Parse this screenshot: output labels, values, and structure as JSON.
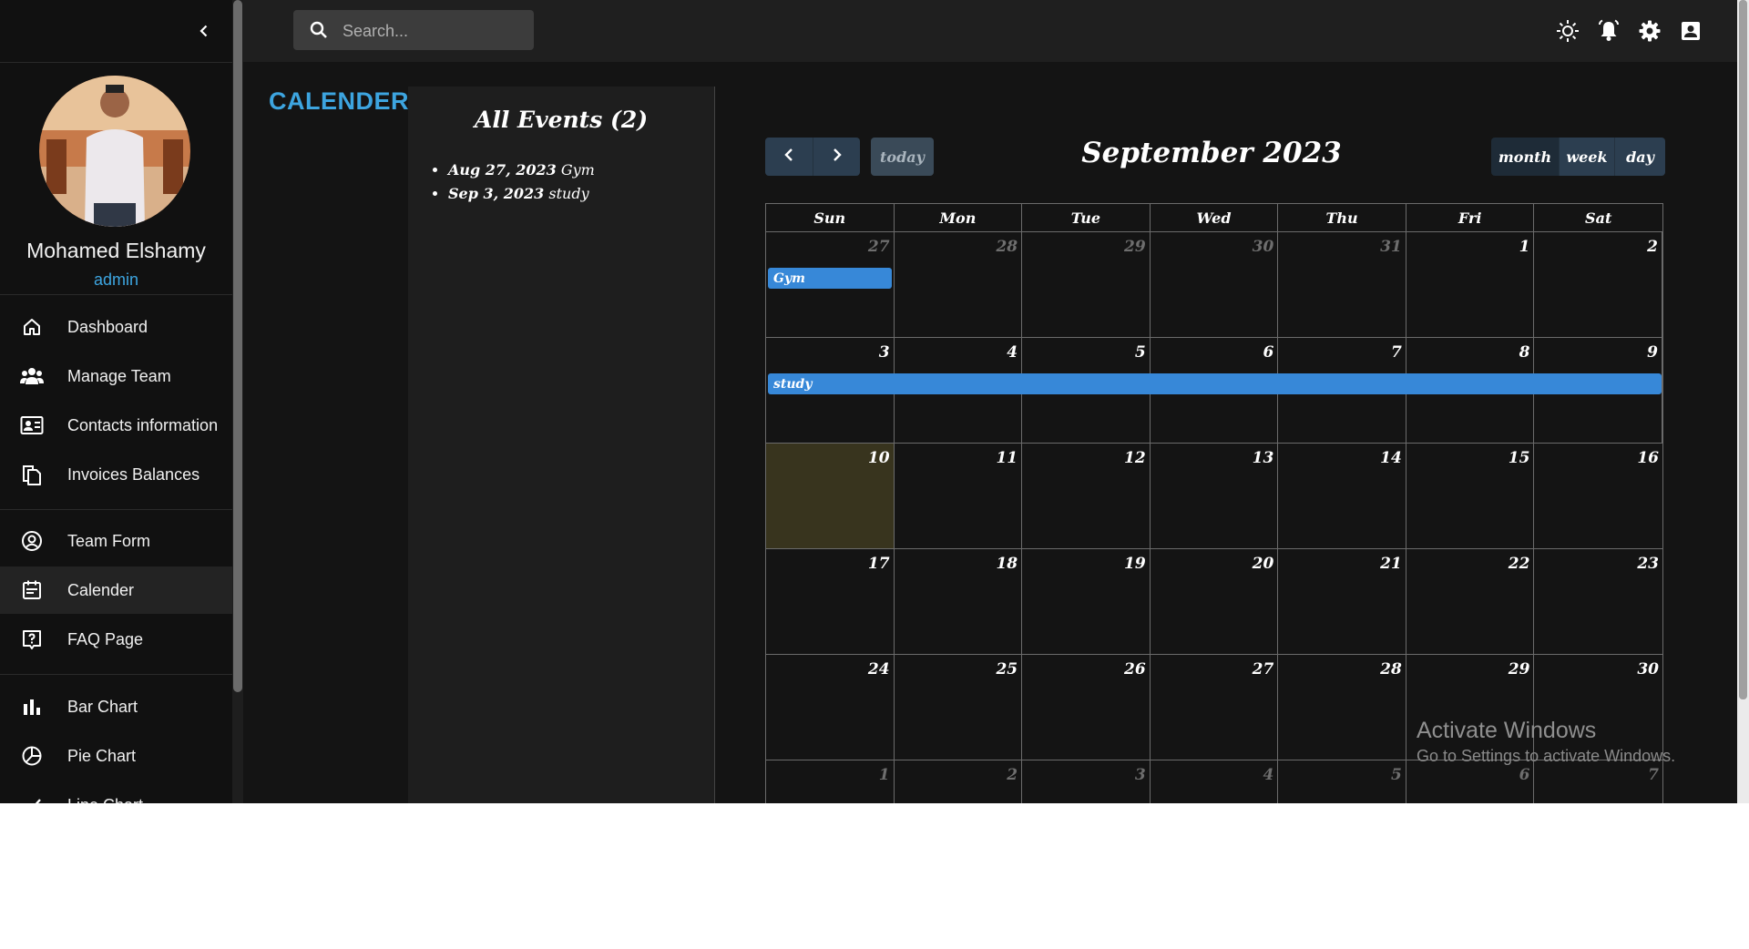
{
  "sidebar": {
    "user": {
      "name": "Mohamed Elshamy",
      "role": "admin"
    },
    "items": [
      {
        "label": "Dashboard",
        "icon": "home-icon"
      },
      {
        "label": "Manage Team",
        "icon": "people-icon"
      },
      {
        "label": "Contacts information",
        "icon": "contacts-card-icon"
      },
      {
        "label": "Invoices Balances",
        "icon": "receipt-icon"
      },
      {
        "label": "Team Form",
        "icon": "person-circle-icon"
      },
      {
        "label": "Calender",
        "icon": "calendar-icon",
        "active": true
      },
      {
        "label": "FAQ Page",
        "icon": "help-icon"
      },
      {
        "label": "Bar Chart",
        "icon": "bar-chart-icon"
      },
      {
        "label": "Pie Chart",
        "icon": "pie-chart-icon"
      },
      {
        "label": "Line Chart",
        "icon": "line-chart-icon"
      }
    ]
  },
  "topbar": {
    "search_placeholder": "Search...",
    "icons": [
      "light-mode-icon",
      "notifications-icon",
      "settings-icon",
      "account-box-icon"
    ]
  },
  "page": {
    "title": "CALENDER"
  },
  "events_panel": {
    "title": "All Events (2)",
    "events": [
      {
        "date": "Aug 27, 2023",
        "title": "Gym"
      },
      {
        "date": "Sep 3, 2023",
        "title": "study"
      }
    ]
  },
  "calendar": {
    "title": "September 2023",
    "today_label": "today",
    "views": [
      "month",
      "week",
      "day"
    ],
    "active_view": "month",
    "weekdays": [
      "Sun",
      "Mon",
      "Tue",
      "Wed",
      "Thu",
      "Fri",
      "Sat"
    ],
    "weeks": [
      [
        {
          "d": "27",
          "o": true
        },
        {
          "d": "28",
          "o": true
        },
        {
          "d": "29",
          "o": true
        },
        {
          "d": "30",
          "o": true
        },
        {
          "d": "31",
          "o": true
        },
        {
          "d": "1"
        },
        {
          "d": "2"
        }
      ],
      [
        {
          "d": "3"
        },
        {
          "d": "4"
        },
        {
          "d": "5"
        },
        {
          "d": "6"
        },
        {
          "d": "7"
        },
        {
          "d": "8"
        },
        {
          "d": "9"
        }
      ],
      [
        {
          "d": "10",
          "t": true
        },
        {
          "d": "11"
        },
        {
          "d": "12"
        },
        {
          "d": "13"
        },
        {
          "d": "14"
        },
        {
          "d": "15"
        },
        {
          "d": "16"
        }
      ],
      [
        {
          "d": "17"
        },
        {
          "d": "18"
        },
        {
          "d": "19"
        },
        {
          "d": "20"
        },
        {
          "d": "21"
        },
        {
          "d": "22"
        },
        {
          "d": "23"
        }
      ],
      [
        {
          "d": "24"
        },
        {
          "d": "25"
        },
        {
          "d": "26"
        },
        {
          "d": "27"
        },
        {
          "d": "28"
        },
        {
          "d": "29"
        },
        {
          "d": "30"
        }
      ],
      [
        {
          "d": "1",
          "o": true
        },
        {
          "d": "2",
          "o": true
        },
        {
          "d": "3",
          "o": true
        },
        {
          "d": "4",
          "o": true
        },
        {
          "d": "5",
          "o": true
        },
        {
          "d": "6",
          "o": true
        },
        {
          "d": "7",
          "o": true
        }
      ]
    ],
    "grid_events": [
      {
        "title": "Gym",
        "week": 0,
        "start_day": 0,
        "span_days": 1
      },
      {
        "title": "study",
        "week": 1,
        "start_day": 0,
        "span_days": 7
      }
    ]
  },
  "watermark": {
    "line1": "Activate Windows",
    "line2": "Go to Settings to activate Windows."
  },
  "colors": {
    "accent": "#3da5e0",
    "event": "#3788d8",
    "today_bg": "#38341e",
    "panel_bg": "#1e1e1e"
  }
}
